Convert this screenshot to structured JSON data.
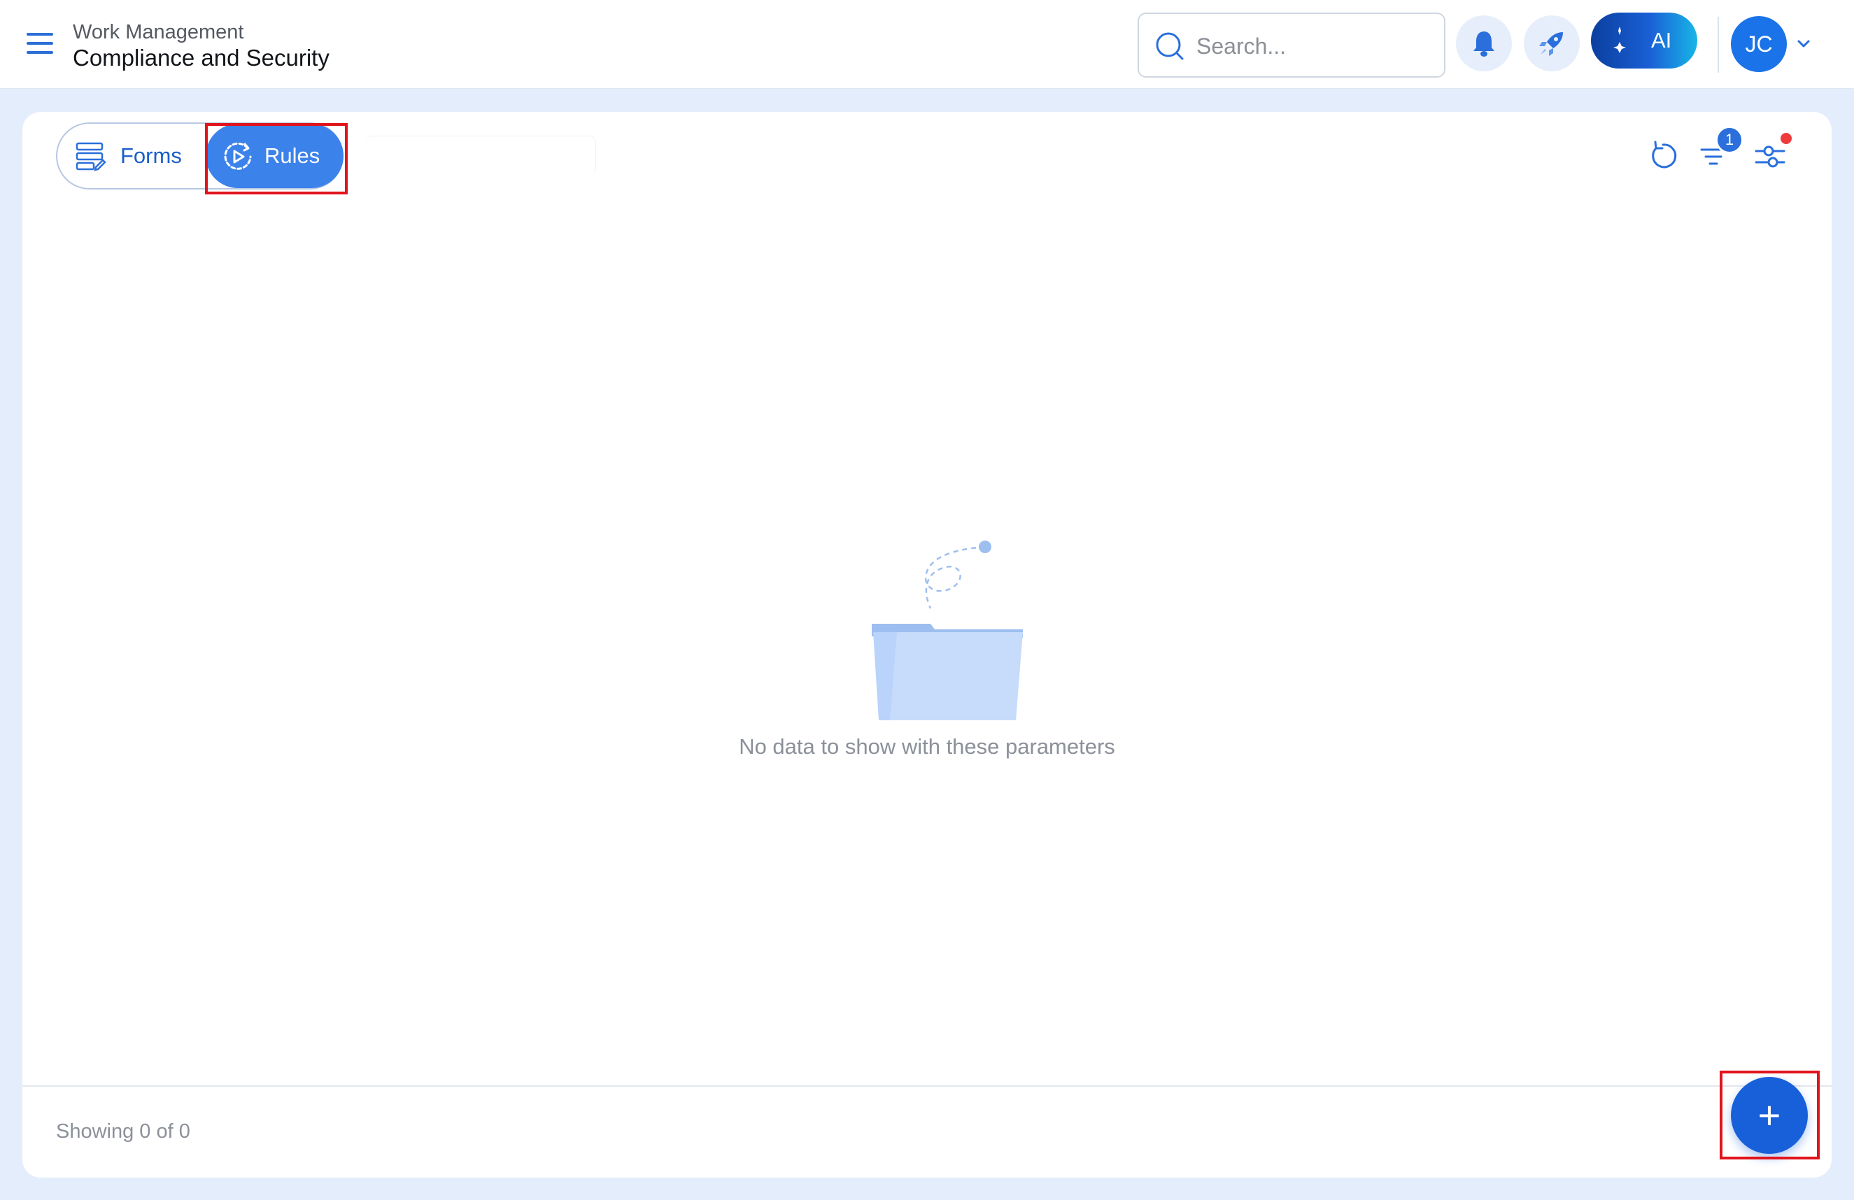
{
  "header": {
    "breadcrumb_parent": "Work Management",
    "title": "Compliance and Security",
    "search_placeholder": "Search...",
    "ai_label": "AI",
    "avatar_initials": "JC"
  },
  "tabs": [
    {
      "label": "Forms",
      "active": false
    },
    {
      "label": "Rules",
      "active": true
    }
  ],
  "toolbar": {
    "filter_badge_count": "1",
    "settings_has_alert": true
  },
  "empty_state": {
    "message": "No data to show with these parameters"
  },
  "footer": {
    "showing_text": "Showing 0 of 0"
  },
  "fab": {
    "label": "+"
  },
  "colors": {
    "primary": "#1760d9",
    "active_tab": "#3b82ea",
    "highlight": "#e1141c",
    "background": "#e3edfb"
  }
}
